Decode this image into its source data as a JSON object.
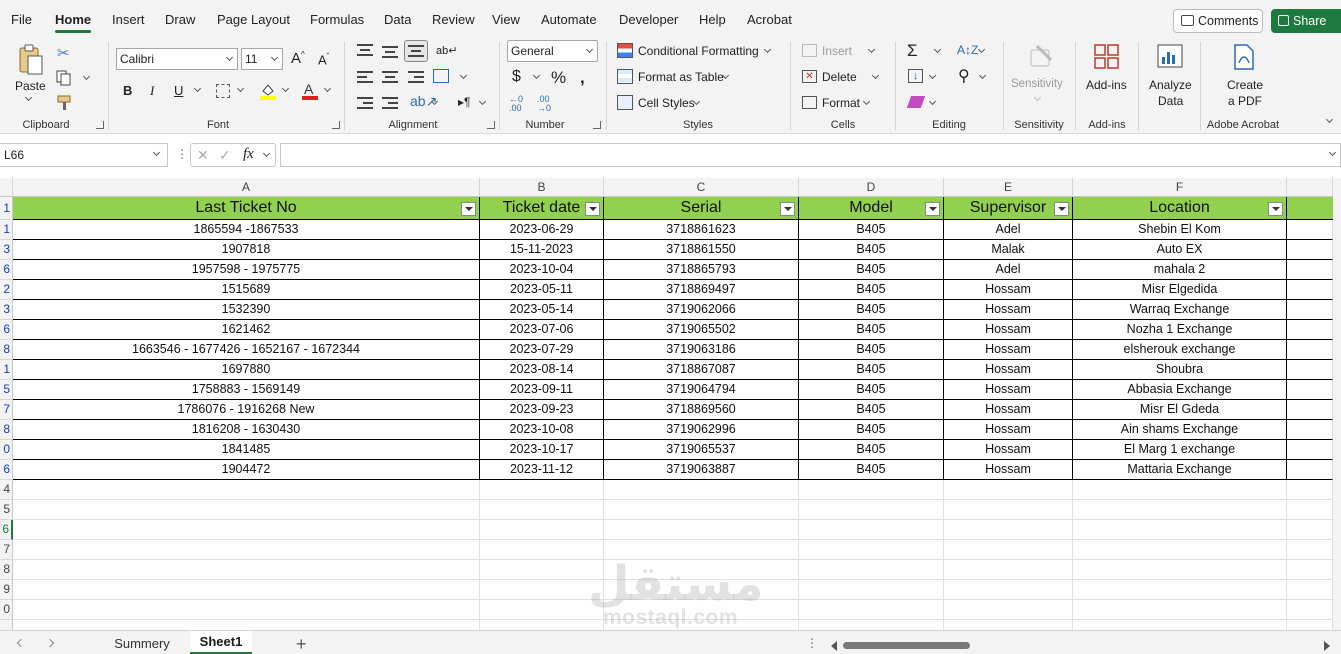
{
  "menu": {
    "tabs": [
      "File",
      "Home",
      "Insert",
      "Draw",
      "Page Layout",
      "Formulas",
      "Data",
      "Review",
      "View",
      "Automate",
      "Developer",
      "Help",
      "Acrobat"
    ],
    "active_tab": "Home",
    "comments_label": "Comments",
    "share_label": "Share"
  },
  "ribbon": {
    "clipboard": {
      "paste_label": "Paste",
      "group_label": "Clipboard"
    },
    "font": {
      "name": "Calibri",
      "size": "11",
      "group_label": "Font"
    },
    "alignment": {
      "group_label": "Alignment"
    },
    "number": {
      "format": "General",
      "group_label": "Number"
    },
    "styles": {
      "conditional_formatting": "Conditional Formatting",
      "format_as_table": "Format as Table",
      "cell_styles": "Cell Styles",
      "group_label": "Styles"
    },
    "cells": {
      "insert": "Insert",
      "delete": "Delete",
      "format": "Format",
      "group_label": "Cells"
    },
    "editing": {
      "group_label": "Editing"
    },
    "sensitivity": {
      "label": "Sensitivity",
      "group_label": "Sensitivity"
    },
    "addins": {
      "label": "Add-ins",
      "group_label": "Add-ins"
    },
    "analyze": {
      "line1": "Analyze",
      "line2": "Data"
    },
    "acrobat": {
      "line1": "Create",
      "line2": "a PDF",
      "group_label": "Adobe Acrobat"
    }
  },
  "formula_bar": {
    "name_box": "L66",
    "fx": "fx",
    "value": ""
  },
  "sheet": {
    "column_letters": [
      "A",
      "B",
      "C",
      "D",
      "E",
      "F"
    ],
    "header_row_number": "1",
    "headers": [
      "Last Ticket No",
      "Ticket date",
      "Serial",
      "Model",
      "Supervisor",
      "Location"
    ],
    "rows": [
      {
        "n": "1",
        "cells": [
          "1865594 -1867533",
          "2023-06-29",
          "3718861623",
          "B405",
          "Adel",
          "Shebin El Kom"
        ]
      },
      {
        "n": "3",
        "cells": [
          "1907818",
          "15-11-2023",
          "3718861550",
          "B405",
          "Malak",
          "Auto EX"
        ]
      },
      {
        "n": "6",
        "cells": [
          "1957598 - 1975775",
          "2023-10-04",
          "3718865793",
          "B405",
          "Adel",
          "mahala 2"
        ]
      },
      {
        "n": "2",
        "cells": [
          "1515689",
          "2023-05-11",
          "3718869497",
          "B405",
          "Hossam",
          "Misr Elgedida"
        ]
      },
      {
        "n": "3",
        "cells": [
          "1532390",
          "2023-05-14",
          "3719062066",
          "B405",
          "Hossam",
          "Warraq Exchange"
        ]
      },
      {
        "n": "6",
        "cells": [
          "1621462",
          "2023-07-06",
          "3719065502",
          "B405",
          "Hossam",
          "Nozha 1 Exchange"
        ]
      },
      {
        "n": "8",
        "cells": [
          "1663546 - 1677426  - 1652167 - 1672344",
          "2023-07-29",
          "3719063186",
          "B405",
          "Hossam",
          "elsherouk exchange"
        ]
      },
      {
        "n": "1",
        "cells": [
          "1697880",
          "2023-08-14",
          "3718867087",
          "B405",
          "Hossam",
          "Shoubra"
        ]
      },
      {
        "n": "5",
        "cells": [
          "1758883 - 1569149",
          "2023-09-11",
          "3719064794",
          "B405",
          "Hossam",
          "Abbasia Exchange"
        ]
      },
      {
        "n": "7",
        "cells": [
          "1786076 - 1916268 New",
          "2023-09-23",
          "3718869560",
          "B405",
          "Hossam",
          "Misr El Gdeda"
        ]
      },
      {
        "n": "8",
        "cells": [
          "1816208 - 1630430",
          "2023-10-08",
          "3719062996",
          "B405",
          "Hossam",
          "Ain shams Exchange"
        ]
      },
      {
        "n": "0",
        "cells": [
          "1841485",
          "2023-10-17",
          "3719065537",
          "B405",
          "Hossam",
          "El Marg 1 exchange"
        ]
      },
      {
        "n": "6",
        "cells": [
          "1904472",
          "2023-11-12",
          "3719063887",
          "B405",
          "Hossam",
          "Mattaria Exchange"
        ]
      }
    ],
    "empty_row_numbers": [
      "4",
      "5",
      "6",
      "7",
      "8",
      "9",
      "0",
      ""
    ]
  },
  "watermark": {
    "arabic": "مستقل",
    "latin": "mostaql.com"
  },
  "tabs": {
    "sheets": [
      "Summery",
      "Sheet1"
    ],
    "active": "Sheet1"
  },
  "colors": {
    "header_fill": "#92d050",
    "accent": "#1d7a3e"
  }
}
